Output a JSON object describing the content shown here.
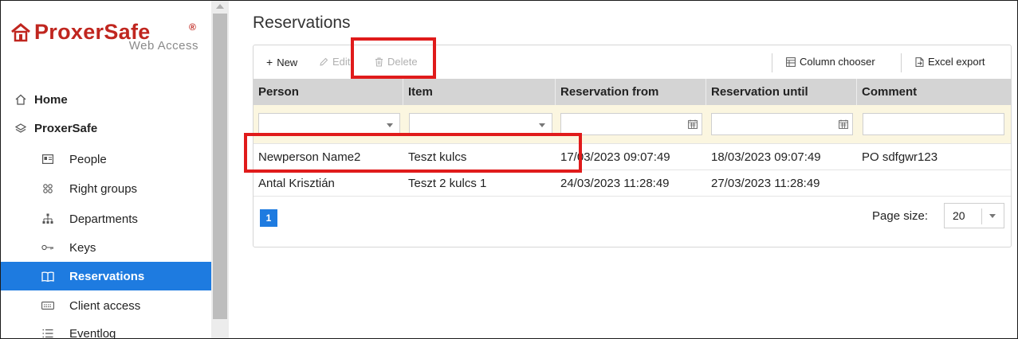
{
  "brand": {
    "name": "ProxerSafe",
    "registered": "®",
    "subtitle": "Web Access"
  },
  "sidebar": {
    "items": [
      {
        "label": "Home",
        "icon": "home-icon"
      },
      {
        "label": "ProxerSafe",
        "icon": "layers-icon"
      },
      {
        "label": "People",
        "icon": "id-card-icon"
      },
      {
        "label": "Right groups",
        "icon": "group-icon"
      },
      {
        "label": "Departments",
        "icon": "org-chart-icon"
      },
      {
        "label": "Keys",
        "icon": "key-icon"
      },
      {
        "label": "Reservations",
        "icon": "book-icon",
        "active": true
      },
      {
        "label": "Client access",
        "icon": "keyboard-icon"
      },
      {
        "label": "Eventlog",
        "icon": "list-icon"
      }
    ]
  },
  "page": {
    "title": "Reservations"
  },
  "toolbar": {
    "new_label": "New",
    "edit_label": "Edit",
    "delete_label": "Delete",
    "column_chooser_label": "Column chooser",
    "excel_export_label": "Excel export"
  },
  "grid": {
    "columns": [
      "Person",
      "Item",
      "Reservation from",
      "Reservation until",
      "Comment"
    ],
    "rows": [
      [
        "Newperson Name2",
        "Teszt kulcs",
        "17/03/2023 09:07:49",
        "18/03/2023 09:07:49",
        "PO sdfgwr123"
      ],
      [
        "Antal Krisztián",
        "Teszt 2 kulcs 1",
        "24/03/2023 11:28:49",
        "27/03/2023 11:28:49",
        ""
      ]
    ]
  },
  "pager": {
    "current_page": "1",
    "page_size_label": "Page size:",
    "page_size": "20"
  },
  "colors": {
    "accent": "#1e7be0",
    "brand": "#c0261f",
    "annotation": "#e01b1b",
    "filter_bg": "#fbf6e0",
    "header_bg": "#d4d4d4"
  }
}
